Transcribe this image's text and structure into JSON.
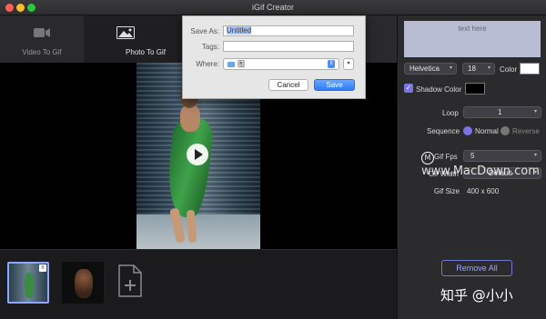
{
  "window": {
    "title": "iGif Creator"
  },
  "tabs": [
    {
      "label": "Video To Gif",
      "icon": "video-camera-icon"
    },
    {
      "label": "Photo To Gif",
      "icon": "image-icon"
    }
  ],
  "save_dialog": {
    "save_as_label": "Save As:",
    "save_as_value": "Untitled",
    "tags_label": "Tags:",
    "tags_value": "",
    "where_label": "Where:",
    "where_value": "图",
    "cancel_label": "Cancel",
    "save_label": "Save"
  },
  "text_panel": {
    "placeholder": "text here",
    "font": "Helvetica",
    "size": "18",
    "color_label": "Color",
    "shadow_label": "Shadow Color",
    "text_color": "#ffffff",
    "shadow_color": "#000000"
  },
  "settings": {
    "loop_label": "Loop",
    "loop_value": "1",
    "sequence_label": "Sequence",
    "sequence_normal": "Normal",
    "sequence_reverse": "Reverse",
    "fps_label": "Gif Fps",
    "fps_value": "5",
    "width_label": "Gif Width",
    "width_value": "Default",
    "size_label": "Gif Size",
    "size_value": "400 x 600"
  },
  "actions": {
    "remove_all": "Remove All"
  },
  "thumbnail_close": "x",
  "watermarks": {
    "macdown": "www.MacDown.com",
    "zhihu": "知乎 @小小"
  },
  "colors": {
    "accent": "#6a6af0",
    "save_button": "#2f7cf6"
  }
}
